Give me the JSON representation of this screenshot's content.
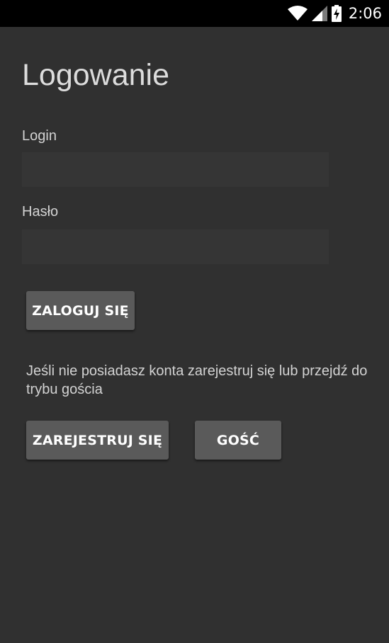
{
  "status_bar": {
    "time": "2:06",
    "icons": [
      "wifi-icon",
      "signal-icon",
      "battery-charging-icon"
    ]
  },
  "screen": {
    "title": "Logowanie"
  },
  "form": {
    "login_label": "Login",
    "login_value": "",
    "password_label": "Hasło",
    "password_value": "",
    "login_button": "ZALOGUJ SIĘ"
  },
  "info": {
    "text": "Jeśli nie posiadasz konta zarejestruj się lub przejdź do trybu gościa"
  },
  "actions": {
    "register_button": "ZAREJESTRUJ SIĘ",
    "guest_button": "GOŚĆ"
  },
  "colors": {
    "background": "#303030",
    "input_background": "#353535",
    "button_background": "#5a5a5a",
    "status_bar": "#000000"
  }
}
